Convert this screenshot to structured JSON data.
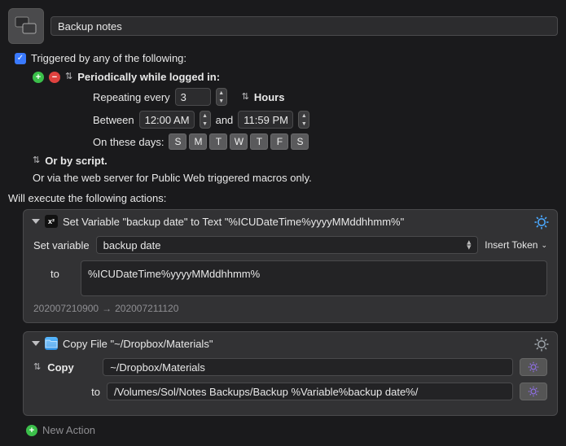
{
  "title": "Backup notes",
  "triggered_label": "Triggered by any of the following:",
  "periodic_label": "Periodically while logged in:",
  "repeating_label": "Repeating every",
  "repeat_value": "3",
  "repeat_unit": "Hours",
  "between_label": "Between",
  "between_start": "12:00 AM",
  "and_label": "and",
  "between_end": "11:59 PM",
  "days_label": "On these days:",
  "days": [
    "S",
    "M",
    "T",
    "W",
    "T",
    "F",
    "S"
  ],
  "or_script": "Or by script.",
  "or_web": "Or via the web server for Public Web triggered macros only.",
  "exec_label": "Will execute the following actions:",
  "action1": {
    "title": "Set Variable \"backup date\" to Text \"%ICUDateTime%yyyyMMddhhmm%\"",
    "set_variable_label": "Set variable",
    "variable_name": "backup date",
    "insert_token": "Insert Token",
    "to_label": "to",
    "value": "%ICUDateTime%yyyyMMddhhmm%",
    "preview_from": "202007210900",
    "preview_to": "202007211120"
  },
  "action2": {
    "title": "Copy File \"~/Dropbox/Materials\"",
    "copy_label": "Copy",
    "source": "~/Dropbox/Materials",
    "to_label": "to",
    "dest": "/Volumes/Sol/Notes Backups/Backup %Variable%backup date%/"
  },
  "new_action": "New Action"
}
